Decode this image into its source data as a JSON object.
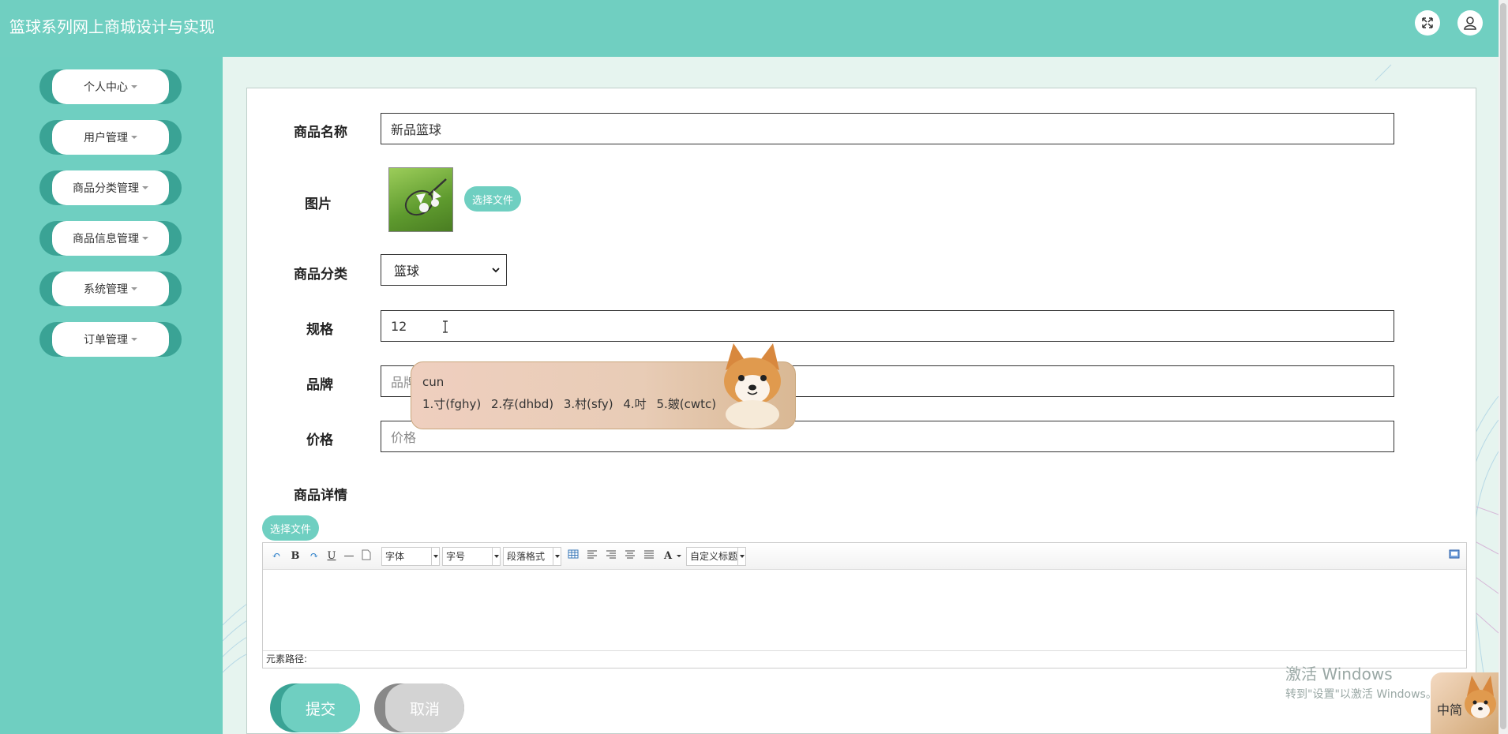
{
  "app": {
    "title": "篮球系列网上商城设计与实现"
  },
  "header": {
    "fullscreen_icon": "expand-icon",
    "user_icon": "user-icon"
  },
  "sidebar": {
    "items": [
      {
        "label": "个人中心"
      },
      {
        "label": "用户管理"
      },
      {
        "label": "商品分类管理"
      },
      {
        "label": "商品信息管理"
      },
      {
        "label": "系统管理"
      },
      {
        "label": "订单管理"
      }
    ]
  },
  "form": {
    "name_label": "商品名称",
    "name_value": "新品篮球",
    "image_label": "图片",
    "file_button": "选择文件",
    "category_label": "商品分类",
    "category_value": "篮球",
    "spec_label": "规格",
    "spec_value": "12",
    "brand_label": "品牌",
    "brand_placeholder": "品牌",
    "price_label": "价格",
    "price_placeholder": "价格",
    "detail_label": "商品详情",
    "detail_file_button": "选择文件"
  },
  "editor": {
    "font_combo": "字体",
    "size_combo": "字号",
    "paragraph_combo": "段落格式",
    "custom_title_combo": "自定义标题",
    "bold": "B",
    "underline": "U",
    "font_color": "A",
    "status_path": "元素路径:"
  },
  "ime": {
    "input": "cun",
    "candidates": [
      "1.寸(fghy)",
      "2.存(dhbd)",
      "3.村(sfy)",
      "4.吋",
      "5.皴(cwtc)"
    ]
  },
  "actions": {
    "submit": "提交",
    "cancel": "取消"
  },
  "system": {
    "watermark_line1": "激活 Windows",
    "watermark_line2": "转到\"设置\"以激活 Windows。",
    "ime_badge": "中简"
  },
  "colors": {
    "primary": "#6fcfc1",
    "primary_dark": "#3aa395",
    "cancel": "#d3d3d3"
  }
}
